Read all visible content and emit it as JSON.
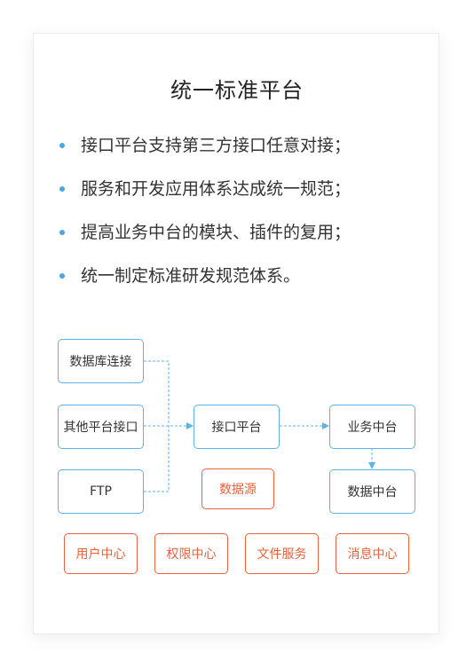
{
  "title": "统一标准平台",
  "bullets": [
    "接口平台支持第三方接口任意对接；",
    "服务和开发应用体系达成统一规范；",
    "提高业务中台的模块、插件的复用；",
    "统一制定标准研发规范体系。"
  ],
  "diagram": {
    "sources": [
      "数据库连接",
      "其他平台接口",
      "FTP"
    ],
    "interface_platform": "接口平台",
    "data_source": "数据源",
    "business_center": "业务中台",
    "data_center": "数据中台",
    "bottom_services": [
      "用户中心",
      "权限中心",
      "文件服务",
      "消息中心"
    ]
  },
  "colors": {
    "accent_blue": "#5db2e8",
    "accent_orange": "#e8623c",
    "bullet_dot": "#4aa6e4"
  }
}
